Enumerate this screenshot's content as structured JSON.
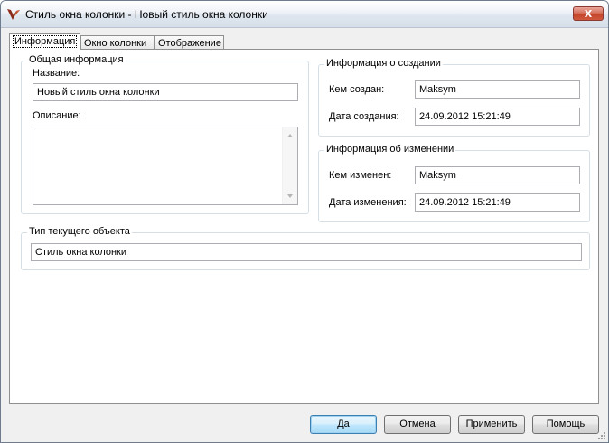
{
  "window": {
    "title": "Стиль окна колонки - Новый стиль окна колонки",
    "close_label": "X"
  },
  "tabs": [
    {
      "label": "Информация",
      "active": true
    },
    {
      "label": "Окно колонки",
      "active": false
    },
    {
      "label": "Отображение",
      "active": false
    }
  ],
  "general": {
    "caption": "Общая информация",
    "name_label": "Название:",
    "name_value": "Новый стиль окна колонки",
    "description_label": "Описание:",
    "description_value": ""
  },
  "created": {
    "caption": "Информация о создании",
    "by_label": "Кем создан:",
    "by_value": "Maksym",
    "date_label": "Дата создания:",
    "date_value": "24.09.2012 15:21:49"
  },
  "modified": {
    "caption": "Информация об изменении",
    "by_label": "Кем изменен:",
    "by_value": "Maksym",
    "date_label": "Дата изменения:",
    "date_value": "24.09.2012 15:21:49"
  },
  "object_type": {
    "caption": "Тип текущего объекта",
    "value": "Стиль окна колонки"
  },
  "buttons": {
    "ok": "Да",
    "cancel": "Отмена",
    "apply": "Применить",
    "help": "Помощь"
  },
  "colors": {
    "app_icon": "#8b2b1c",
    "close_button": "#c2432a",
    "default_button": "#3c7fb1"
  },
  "icons": {
    "app": "app-logo-icon",
    "close": "close-icon",
    "scroll_up": "scroll-up-icon",
    "scroll_down": "scroll-down-icon",
    "grip": "resize-grip-icon"
  }
}
